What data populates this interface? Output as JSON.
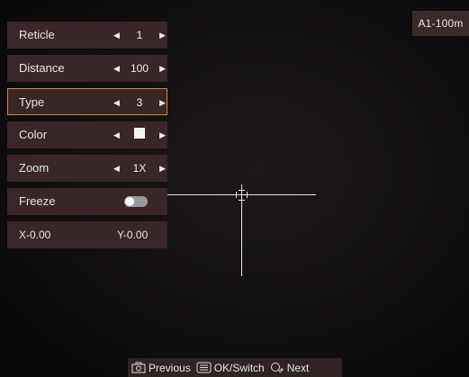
{
  "profile": "A1-100m",
  "menu": {
    "reticle": {
      "label": "Reticle",
      "value": "1"
    },
    "distance": {
      "label": "Distance",
      "value": "100"
    },
    "type": {
      "label": "Type",
      "value": "3"
    },
    "color": {
      "label": "Color",
      "value_color": "#f3f3f3"
    },
    "zoom": {
      "label": "Zoom",
      "value": "1X"
    },
    "freeze": {
      "label": "Freeze",
      "state": "off"
    },
    "offset": {
      "x": "X-0.00",
      "y": "Y-0.00"
    }
  },
  "hints": {
    "previous": "Previous",
    "ok_switch": "OK/Switch",
    "next": "Next"
  },
  "icons": {
    "previous": "camera-icon",
    "ok_switch": "menu-icon",
    "next": "zoom-icon"
  },
  "colors": {
    "row_bg": "#3a2626",
    "selected_border": "#d08a3a",
    "reticle": "#e9e9e9"
  }
}
